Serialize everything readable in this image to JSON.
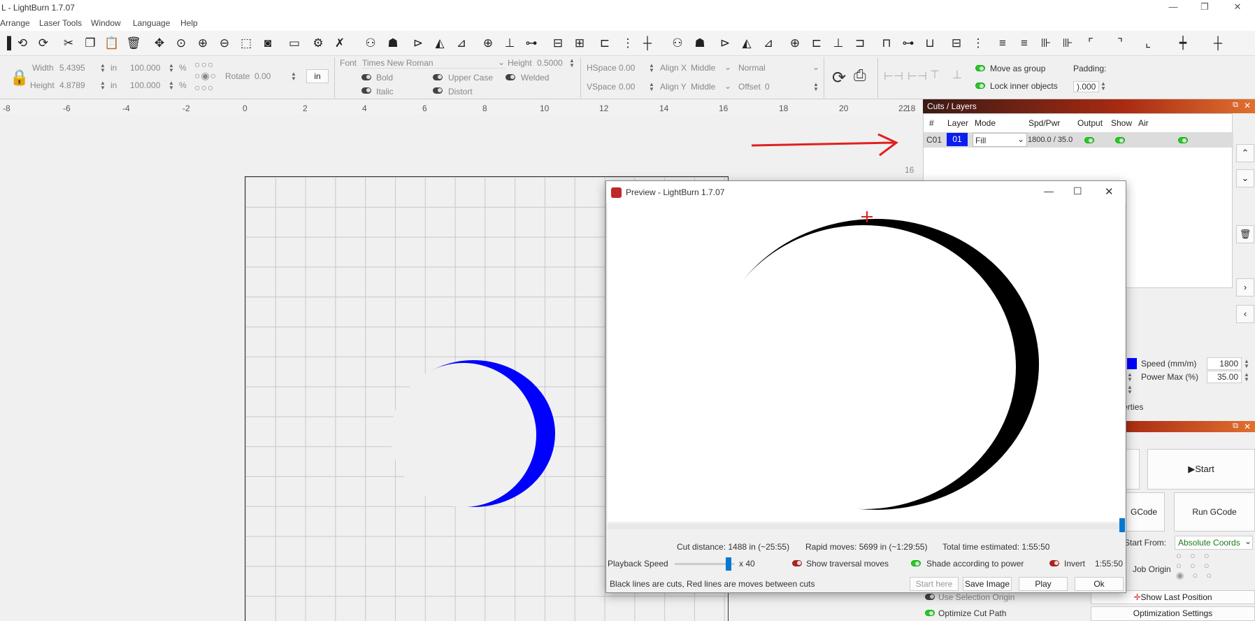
{
  "window": {
    "title": "L - LightBurn 1.7.07",
    "minimize": "—",
    "maximize": "❐",
    "close": "✕"
  },
  "menu": [
    "Arrange",
    "Laser Tools",
    "Window",
    "Language",
    "Help"
  ],
  "toolbar": {
    "icons": [
      "open-icon",
      "undo-icon",
      "redo-icon",
      "cut-icon",
      "copy-icon",
      "paste-icon",
      "delete-icon",
      "move-icon",
      "zoom-selection-icon",
      "zoom-in-icon",
      "zoom-out-icon",
      "zoom-frame-icon",
      "camera-icon",
      "monitor-icon",
      "settings-icon",
      "tools-icon",
      "group-icon",
      "ungroup-icon",
      "mirror-h-icon",
      "mirror-v-icon",
      "mirror-line-icon",
      "target-icon",
      "align-icon",
      "distribute-icon",
      "align-center-icon",
      "align-left-icon",
      "align-middle-icon",
      "align-right-icon",
      "align-top-icon",
      "align-bottom-icon",
      "distribute-h-icon",
      "distribute-v-icon",
      "group2-icon",
      "ungroup2-icon",
      "mirror-h2-icon",
      "mirror-v2-icon",
      "mirror-line2-icon",
      "target2-icon",
      "align-left2-icon",
      "align-hcenter2-icon",
      "align-right2-icon",
      "align-top2-icon",
      "align-vcenter2-icon",
      "align-bottom2-icon",
      "distribute-h2-icon",
      "distribute-v2-icon",
      "space-h-icon",
      "space-v-icon",
      "size-h-icon",
      "size-v-icon",
      "corner-tl-icon",
      "corner-tr-icon",
      "corner-bl-icon",
      "move-h-icon",
      "move-v-icon"
    ]
  },
  "props": {
    "width_label": "Width",
    "width_value": "5.4395",
    "height_label": "Height",
    "height_value": "4.8789",
    "unit": "in",
    "scale_w": "100.000",
    "scale_h": "100.000",
    "percent": "%",
    "rotate_label": "Rotate",
    "rotate_value": "0.00",
    "unit_button": "in",
    "font_label": "Font",
    "font_value": "Times New Roman",
    "text_height_label": "Height",
    "text_height_value": "0.5000",
    "hspace_label": "HSpace",
    "hspace_value": "0.00",
    "vspace_label": "VSpace",
    "vspace_value": "0.00",
    "alignx_label": "Align X",
    "alignx_value": "Middle",
    "aligny_label": "Align Y",
    "aligny_value": "Middle",
    "mode_value": "Normal",
    "offset_label": "Offset",
    "offset_value": "0",
    "bold": "Bold",
    "italic": "Italic",
    "upper_case": "Upper Case",
    "distort": "Distort",
    "welded": "Welded",
    "move_as_group": "Move as group",
    "lock_inner": "Lock inner objects",
    "padding_label": "Padding:",
    "padding_value": ").000"
  },
  "ruler": {
    "ticks": [
      "-8",
      "-6",
      "-4",
      "-2",
      "0",
      "2",
      "4",
      "6",
      "8",
      "10",
      "12",
      "14",
      "16",
      "18",
      "20",
      "22"
    ],
    "right_edge": "18",
    "vertical_label": "16"
  },
  "cuts": {
    "title": "Cuts / Layers",
    "columns": [
      "#",
      "Layer",
      "Mode",
      "Spd/Pwr",
      "Output",
      "Show",
      "Air"
    ],
    "rows": [
      {
        "id": "C01",
        "layer": "01",
        "mode": "Fill",
        "spdpwr": "1800.0 / 35.0"
      }
    ],
    "layer_color": "#0a1ef0"
  },
  "side_props": {
    "speed_label": "Speed (mm/m)",
    "speed_value": "1800",
    "power_label": "Power Max (%)",
    "power_value": "35.00",
    "tab_fragment": "erties"
  },
  "laser": {
    "start": "Start",
    "save_gcode": "GCode",
    "run_gcode": "Run GCode",
    "start_from_label": "Start From:",
    "start_from_value": "Absolute Coords",
    "job_origin_label": "Job Origin",
    "use_selection_origin": "Use Selection Origin",
    "optimize_cut_path": "Optimize Cut Path",
    "show_last_position": "Show Last Position",
    "optimization_settings": "Optimization Settings"
  },
  "preview": {
    "title": "Preview - LightBurn 1.7.07",
    "cut_distance": "Cut distance: 1488 in (~25:55)",
    "rapid_moves": "Rapid moves: 5699 in (~1:29:55)",
    "total_time": "Total time estimated: 1:55:50",
    "playback_label": "Playback Speed",
    "speed_multiplier": "x 40",
    "show_traversal": "Show traversal moves",
    "shade_power": "Shade according to power",
    "invert": "Invert",
    "time_display": "1:55:50",
    "legend_text": "Black lines are cuts, Red lines are moves between cuts",
    "start_here": "Start here",
    "save_image": "Save Image",
    "play": "Play",
    "ok": "Ok",
    "slider_value": 0.9
  },
  "colors": {
    "accent_blue": "#0066cc",
    "layer_blue": "#0000ff",
    "annotation_red": "#e02020",
    "panel_header": "#a82a12"
  }
}
